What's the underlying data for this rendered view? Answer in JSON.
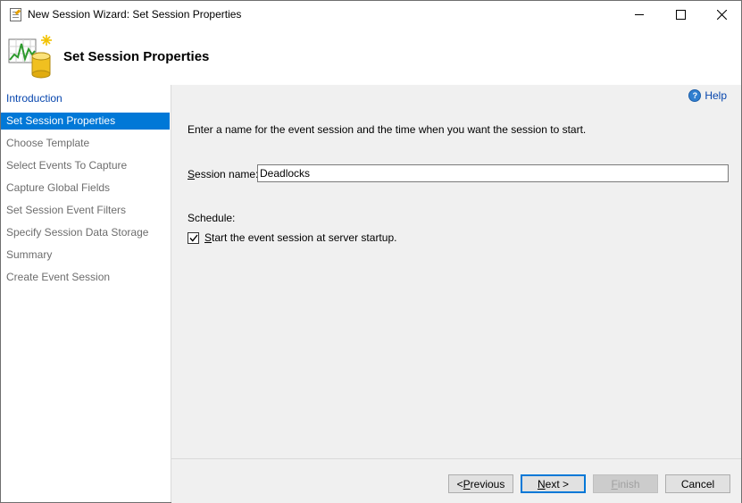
{
  "window": {
    "title": "New Session Wizard: Set Session Properties"
  },
  "header": {
    "title": "Set Session Properties",
    "icon": "event-session-icon"
  },
  "nav": {
    "items": [
      {
        "label": "Introduction",
        "state": "link"
      },
      {
        "label": "Set Session Properties",
        "state": "selected"
      },
      {
        "label": "Choose Template",
        "state": "disabled"
      },
      {
        "label": "Select Events To Capture",
        "state": "disabled"
      },
      {
        "label": "Capture Global Fields",
        "state": "disabled"
      },
      {
        "label": "Set Session Event Filters",
        "state": "disabled"
      },
      {
        "label": "Specify Session Data Storage",
        "state": "disabled"
      },
      {
        "label": "Summary",
        "state": "disabled"
      },
      {
        "label": "Create Event Session",
        "state": "disabled"
      }
    ]
  },
  "content": {
    "help_label": "Help",
    "description": "Enter a name for the event session and the time when you want the session to start.",
    "session_name": {
      "label_accel": "S",
      "label_rest": "ession name:",
      "value": "Deadlocks"
    },
    "schedule_label": "Schedule:",
    "startup_checkbox": {
      "label_accel": "S",
      "label_rest": "tart the event session at server startup.",
      "checked": true
    }
  },
  "footer": {
    "previous": {
      "prefix": "< ",
      "accel": "P",
      "rest": "revious"
    },
    "next": {
      "accel": "N",
      "rest": "ext >"
    },
    "finish": {
      "accel": "F",
      "rest": "inish"
    },
    "cancel": "Cancel"
  },
  "colors": {
    "selection": "#0078d7",
    "link": "#0645ad",
    "disabled_text": "#6d6d6d"
  }
}
